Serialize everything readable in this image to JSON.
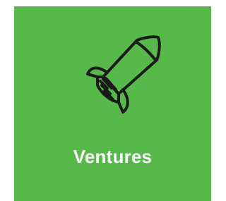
{
  "tile": {
    "label": "Ventures",
    "icon": "rocket-icon",
    "background_color": "#56b949",
    "icon_color": "#1a1a1a",
    "text_color": "#ffffff"
  }
}
